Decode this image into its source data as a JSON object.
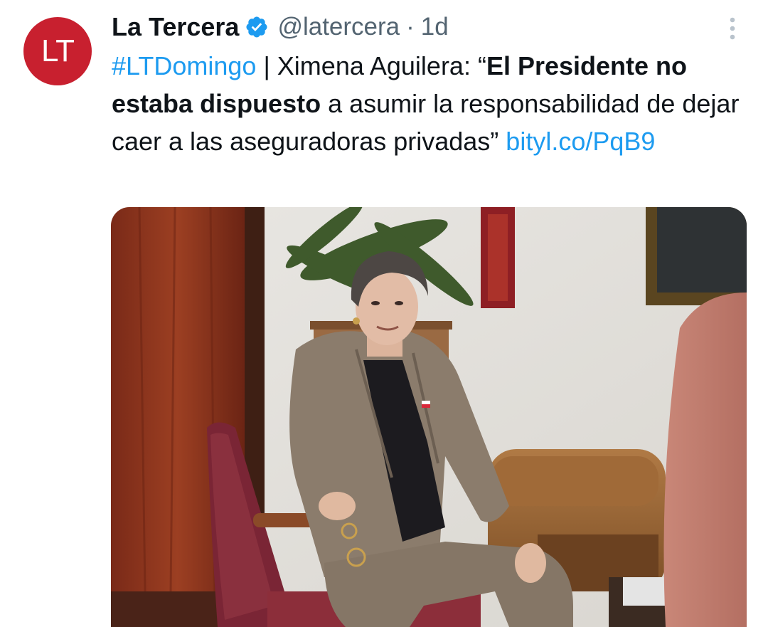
{
  "author": {
    "avatar_initials": "LT",
    "display_name": "La Tercera",
    "handle": "@latercera",
    "separator": "·",
    "time": "1d"
  },
  "tweet": {
    "hashtag": "#LTDomingo",
    "text_after_hashtag": " | Ximena Aguilera: “",
    "bold_text": "El Presidente no estaba dispuesto",
    "text_rest": " a asumir la responsabilidad de dejar caer a las aseguradoras privadas” ",
    "link": "bityl.co/PqB9"
  },
  "icons": {
    "verified": "verified-badge-icon",
    "more": "more-vertical-icon"
  },
  "colors": {
    "accent": "#1d9bf0",
    "avatar_bg": "#c8202f",
    "text_primary": "#0f1419",
    "text_secondary": "#536471"
  }
}
